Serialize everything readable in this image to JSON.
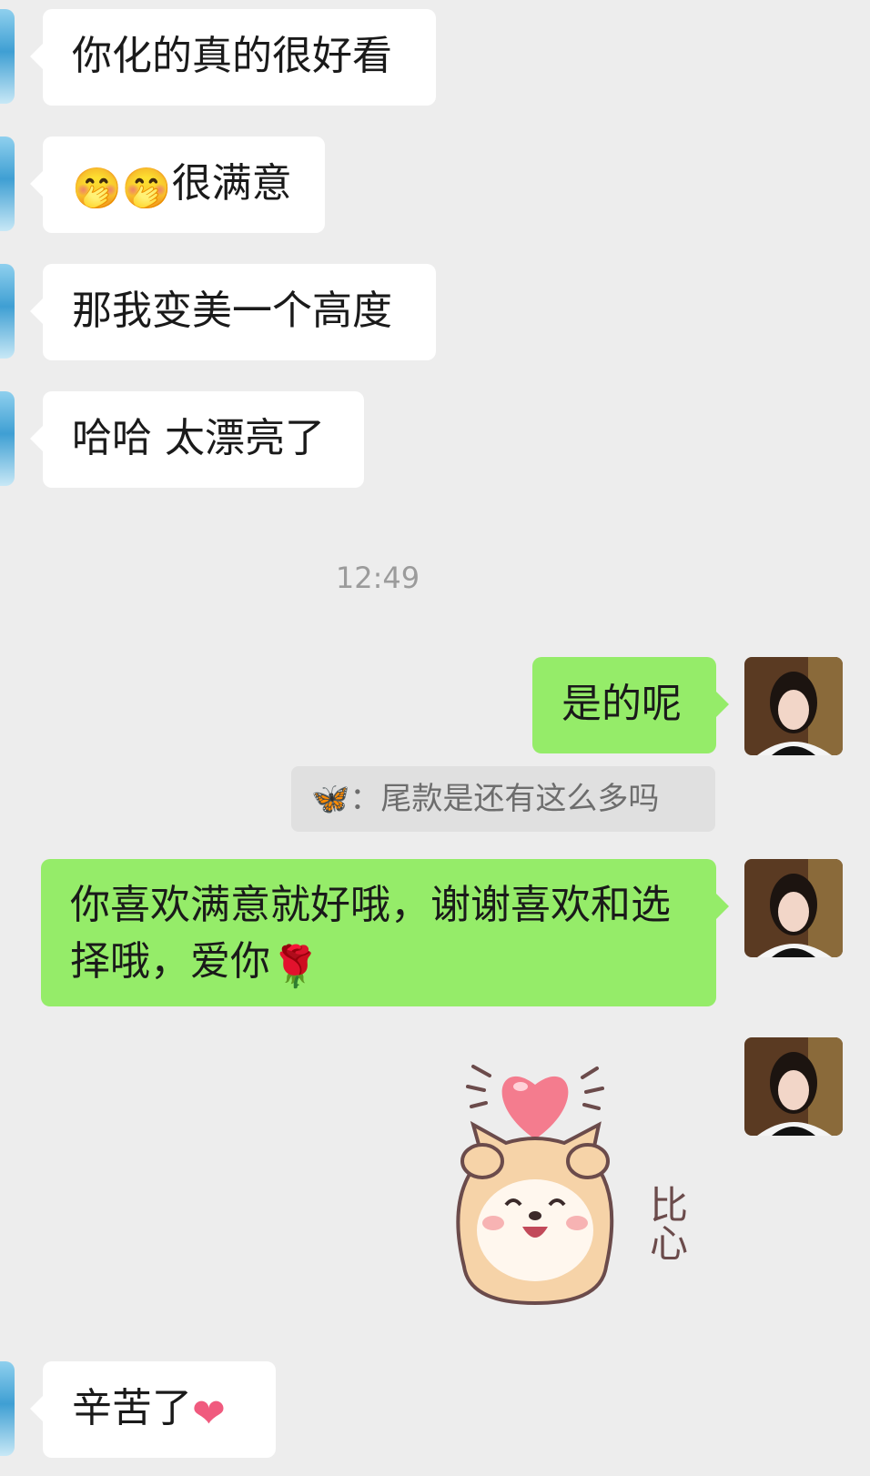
{
  "messages": [
    {
      "side": "in",
      "text": "你化的真的很好看"
    },
    {
      "side": "in",
      "emoji": "🤭🤭",
      "text": "很满意"
    },
    {
      "side": "in",
      "text": "那我变美一个高度"
    },
    {
      "side": "in",
      "text": "哈哈 太漂亮了"
    },
    {
      "side": "out",
      "text": "是的呢"
    },
    {
      "side": "out",
      "text": "你喜欢满意就好哦，谢谢喜欢和选择哦，爱你",
      "emoji": "🌹"
    },
    {
      "side": "out",
      "sticker_text": "比心"
    },
    {
      "side": "in",
      "text": "辛苦了",
      "emoji": "❤"
    }
  ],
  "timestamp": "12:49",
  "quote": {
    "sender_icon": "butterfly-icon",
    "text": "：尾款是还有这么多吗"
  },
  "colors": {
    "background": "#ededed",
    "incoming_bubble": "#ffffff",
    "outgoing_bubble": "#95ec69",
    "quote_bg": "#e0e0e0"
  }
}
